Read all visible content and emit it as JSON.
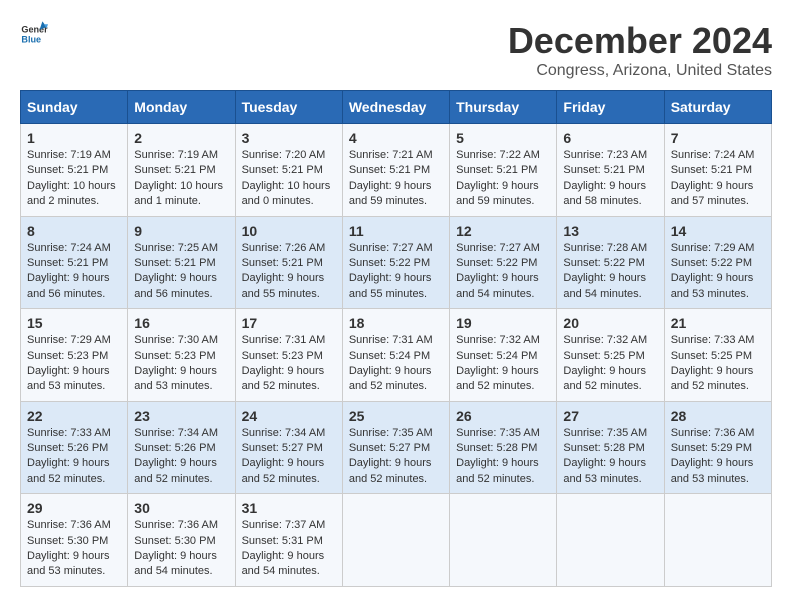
{
  "header": {
    "logo_general": "General",
    "logo_blue": "Blue",
    "title": "December 2024",
    "subtitle": "Congress, Arizona, United States"
  },
  "days_of_week": [
    "Sunday",
    "Monday",
    "Tuesday",
    "Wednesday",
    "Thursday",
    "Friday",
    "Saturday"
  ],
  "weeks": [
    [
      {
        "day": "1",
        "info": "Sunrise: 7:19 AM\nSunset: 5:21 PM\nDaylight: 10 hours\nand 2 minutes."
      },
      {
        "day": "2",
        "info": "Sunrise: 7:19 AM\nSunset: 5:21 PM\nDaylight: 10 hours\nand 1 minute."
      },
      {
        "day": "3",
        "info": "Sunrise: 7:20 AM\nSunset: 5:21 PM\nDaylight: 10 hours\nand 0 minutes."
      },
      {
        "day": "4",
        "info": "Sunrise: 7:21 AM\nSunset: 5:21 PM\nDaylight: 9 hours\nand 59 minutes."
      },
      {
        "day": "5",
        "info": "Sunrise: 7:22 AM\nSunset: 5:21 PM\nDaylight: 9 hours\nand 59 minutes."
      },
      {
        "day": "6",
        "info": "Sunrise: 7:23 AM\nSunset: 5:21 PM\nDaylight: 9 hours\nand 58 minutes."
      },
      {
        "day": "7",
        "info": "Sunrise: 7:24 AM\nSunset: 5:21 PM\nDaylight: 9 hours\nand 57 minutes."
      }
    ],
    [
      {
        "day": "8",
        "info": "Sunrise: 7:24 AM\nSunset: 5:21 PM\nDaylight: 9 hours\nand 56 minutes."
      },
      {
        "day": "9",
        "info": "Sunrise: 7:25 AM\nSunset: 5:21 PM\nDaylight: 9 hours\nand 56 minutes."
      },
      {
        "day": "10",
        "info": "Sunrise: 7:26 AM\nSunset: 5:21 PM\nDaylight: 9 hours\nand 55 minutes."
      },
      {
        "day": "11",
        "info": "Sunrise: 7:27 AM\nSunset: 5:22 PM\nDaylight: 9 hours\nand 55 minutes."
      },
      {
        "day": "12",
        "info": "Sunrise: 7:27 AM\nSunset: 5:22 PM\nDaylight: 9 hours\nand 54 minutes."
      },
      {
        "day": "13",
        "info": "Sunrise: 7:28 AM\nSunset: 5:22 PM\nDaylight: 9 hours\nand 54 minutes."
      },
      {
        "day": "14",
        "info": "Sunrise: 7:29 AM\nSunset: 5:22 PM\nDaylight: 9 hours\nand 53 minutes."
      }
    ],
    [
      {
        "day": "15",
        "info": "Sunrise: 7:29 AM\nSunset: 5:23 PM\nDaylight: 9 hours\nand 53 minutes."
      },
      {
        "day": "16",
        "info": "Sunrise: 7:30 AM\nSunset: 5:23 PM\nDaylight: 9 hours\nand 53 minutes."
      },
      {
        "day": "17",
        "info": "Sunrise: 7:31 AM\nSunset: 5:23 PM\nDaylight: 9 hours\nand 52 minutes."
      },
      {
        "day": "18",
        "info": "Sunrise: 7:31 AM\nSunset: 5:24 PM\nDaylight: 9 hours\nand 52 minutes."
      },
      {
        "day": "19",
        "info": "Sunrise: 7:32 AM\nSunset: 5:24 PM\nDaylight: 9 hours\nand 52 minutes."
      },
      {
        "day": "20",
        "info": "Sunrise: 7:32 AM\nSunset: 5:25 PM\nDaylight: 9 hours\nand 52 minutes."
      },
      {
        "day": "21",
        "info": "Sunrise: 7:33 AM\nSunset: 5:25 PM\nDaylight: 9 hours\nand 52 minutes."
      }
    ],
    [
      {
        "day": "22",
        "info": "Sunrise: 7:33 AM\nSunset: 5:26 PM\nDaylight: 9 hours\nand 52 minutes."
      },
      {
        "day": "23",
        "info": "Sunrise: 7:34 AM\nSunset: 5:26 PM\nDaylight: 9 hours\nand 52 minutes."
      },
      {
        "day": "24",
        "info": "Sunrise: 7:34 AM\nSunset: 5:27 PM\nDaylight: 9 hours\nand 52 minutes."
      },
      {
        "day": "25",
        "info": "Sunrise: 7:35 AM\nSunset: 5:27 PM\nDaylight: 9 hours\nand 52 minutes."
      },
      {
        "day": "26",
        "info": "Sunrise: 7:35 AM\nSunset: 5:28 PM\nDaylight: 9 hours\nand 52 minutes."
      },
      {
        "day": "27",
        "info": "Sunrise: 7:35 AM\nSunset: 5:28 PM\nDaylight: 9 hours\nand 53 minutes."
      },
      {
        "day": "28",
        "info": "Sunrise: 7:36 AM\nSunset: 5:29 PM\nDaylight: 9 hours\nand 53 minutes."
      }
    ],
    [
      {
        "day": "29",
        "info": "Sunrise: 7:36 AM\nSunset: 5:30 PM\nDaylight: 9 hours\nand 53 minutes."
      },
      {
        "day": "30",
        "info": "Sunrise: 7:36 AM\nSunset: 5:30 PM\nDaylight: 9 hours\nand 54 minutes."
      },
      {
        "day": "31",
        "info": "Sunrise: 7:37 AM\nSunset: 5:31 PM\nDaylight: 9 hours\nand 54 minutes."
      },
      {
        "day": "",
        "info": ""
      },
      {
        "day": "",
        "info": ""
      },
      {
        "day": "",
        "info": ""
      },
      {
        "day": "",
        "info": ""
      }
    ]
  ]
}
